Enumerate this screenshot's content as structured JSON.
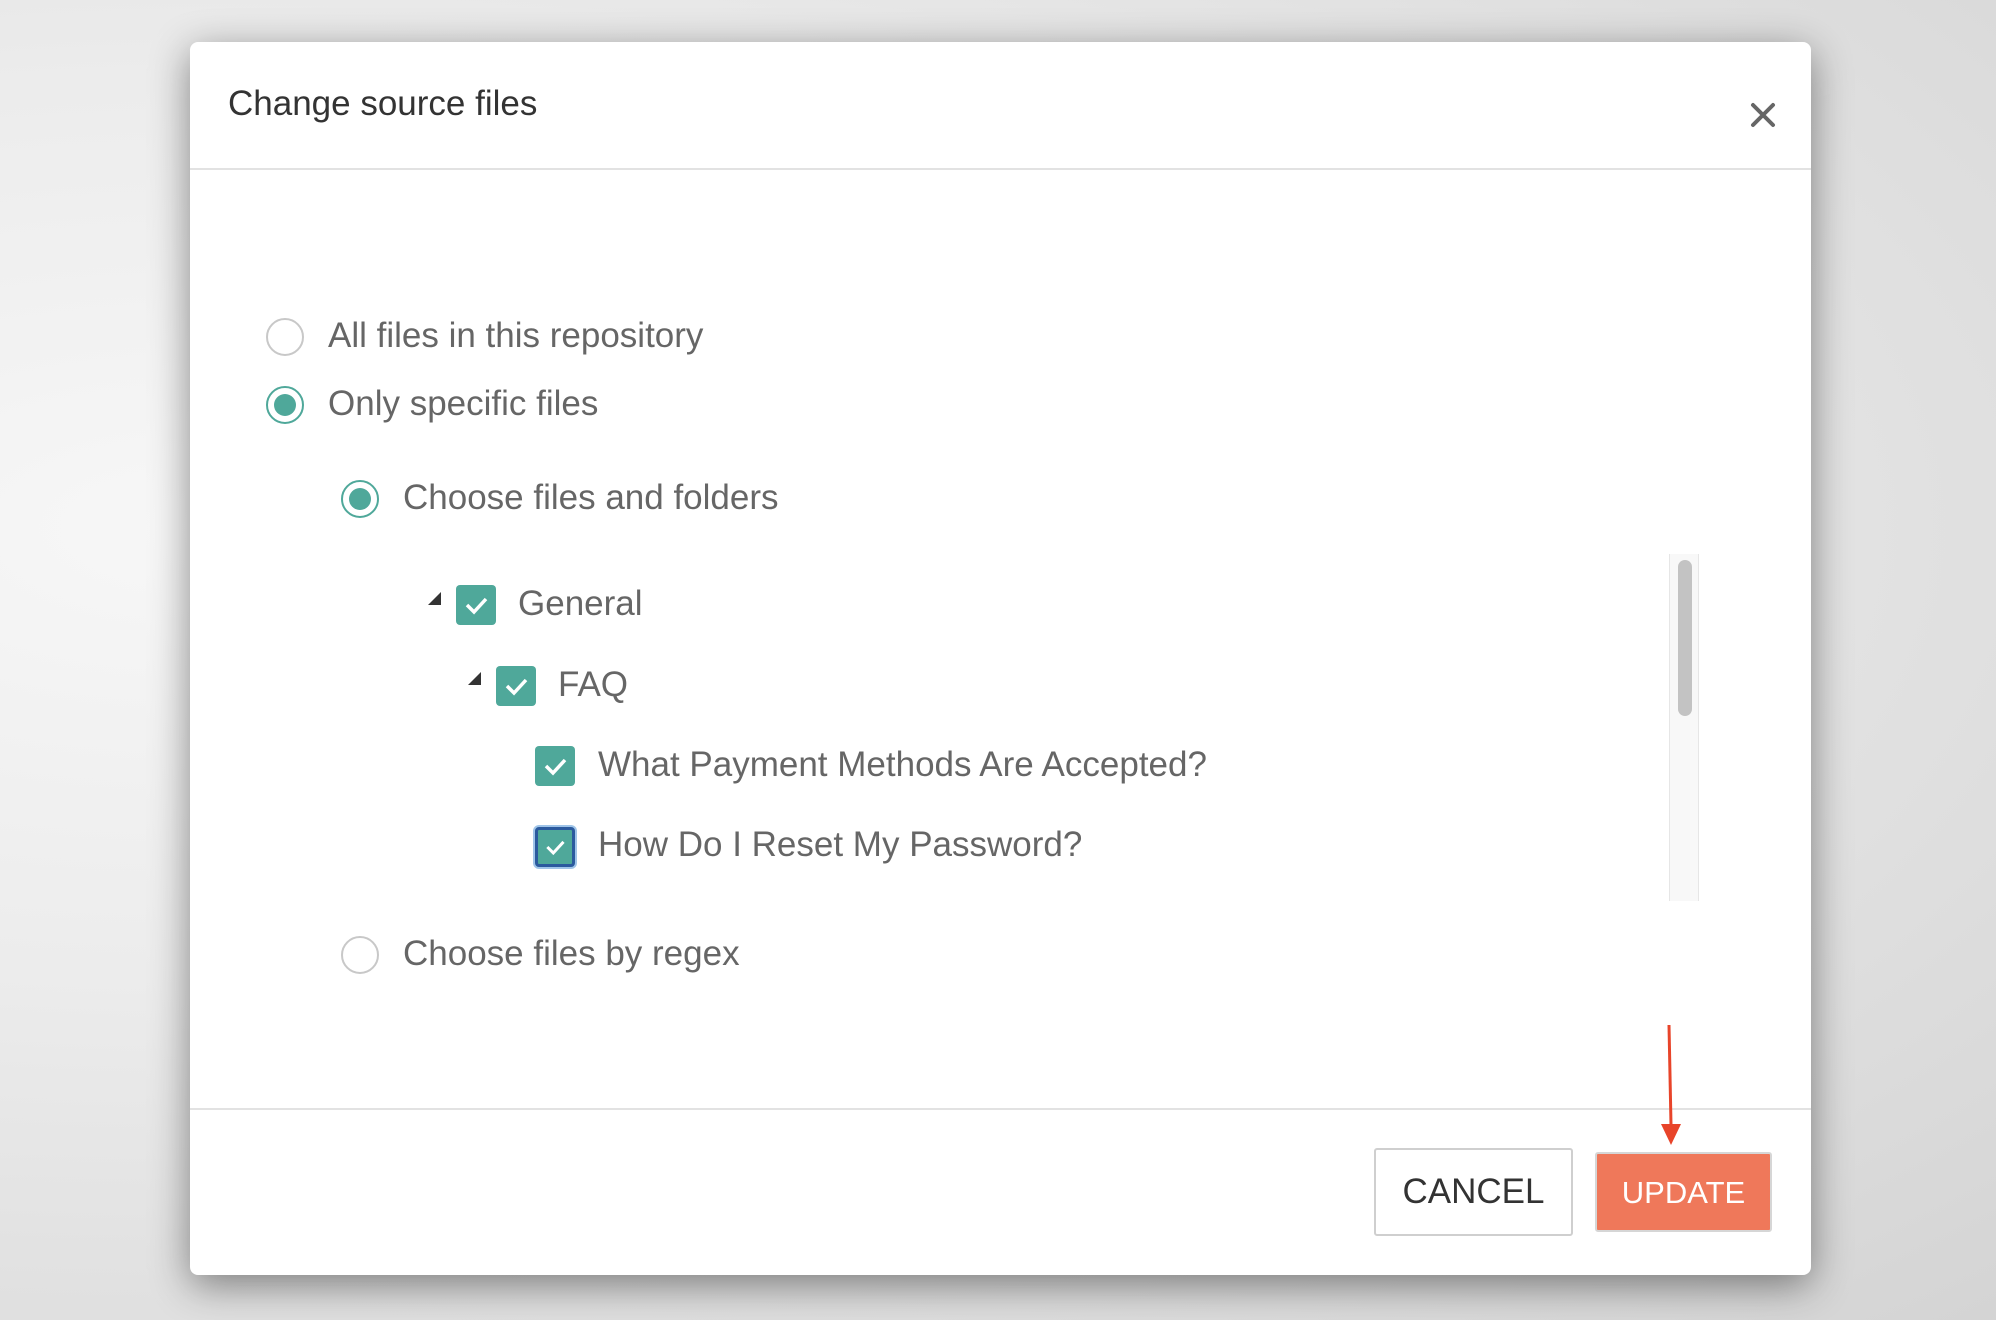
{
  "dialog": {
    "title": "Change source files",
    "close_icon": "close-icon"
  },
  "scope_options": [
    {
      "label": "All files in this repository",
      "selected": false
    },
    {
      "label": "Only specific files",
      "selected": true
    }
  ],
  "specific_options": [
    {
      "label": "Choose files and folders",
      "selected": true
    },
    {
      "label": "Choose files by regex",
      "selected": false
    }
  ],
  "tree": [
    {
      "label": "General",
      "checked": true,
      "expanded": true,
      "level": 0
    },
    {
      "label": "FAQ",
      "checked": true,
      "expanded": true,
      "level": 1
    },
    {
      "label": "What Payment Methods Are Accepted?",
      "checked": true,
      "level": 2
    },
    {
      "label": "How Do I Reset My Password?",
      "checked": true,
      "focused": true,
      "level": 2
    }
  ],
  "footer": {
    "cancel_label": "CANCEL",
    "update_label": "UPDATE"
  },
  "colors": {
    "accent": "#4fa89a",
    "primary_button": "#ef785a",
    "annotation_arrow": "#e8442a"
  }
}
